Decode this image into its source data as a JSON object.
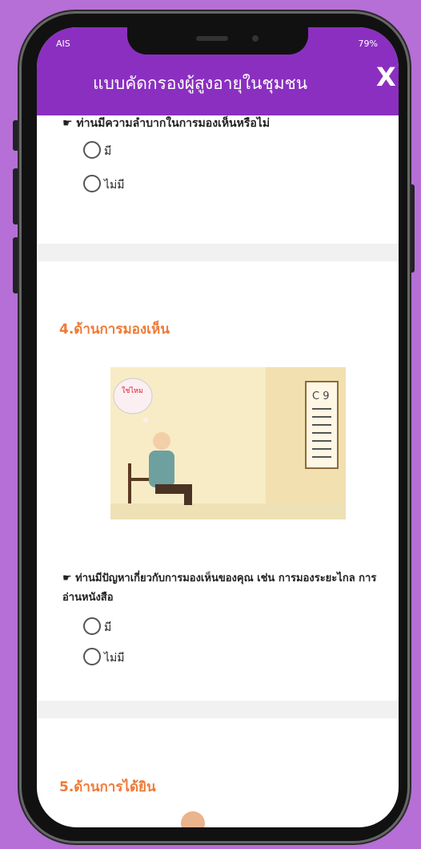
{
  "status": {
    "left": "AIS ",
    "right": "79%"
  },
  "header": {
    "title": "แบบคัดกรองผู้สูงอายุในชุมชน",
    "close_label": "X"
  },
  "sections": [
    {
      "question": "☛ ท่านมีความลำบากในการมองเห็นหรือไม่",
      "options": [
        "มี",
        "ไม่มี"
      ]
    },
    {
      "title": "4.ด้านการมองเห็น",
      "bubble_text": "ใช่ไหม",
      "chart_text": "C 9",
      "question": "☛ ท่านมีปัญหาเกี่ยวกับการมองเห็นของคุณ เช่น การมองระยะไกล การอ่านหนังสือ",
      "options": [
        "มี",
        "ไม่มี"
      ]
    },
    {
      "title": "5.ด้านการได้ยิน"
    }
  ],
  "colors": {
    "accent": "#8b2fc0",
    "section_title": "#ef7a36",
    "background": "#b56fd6"
  }
}
